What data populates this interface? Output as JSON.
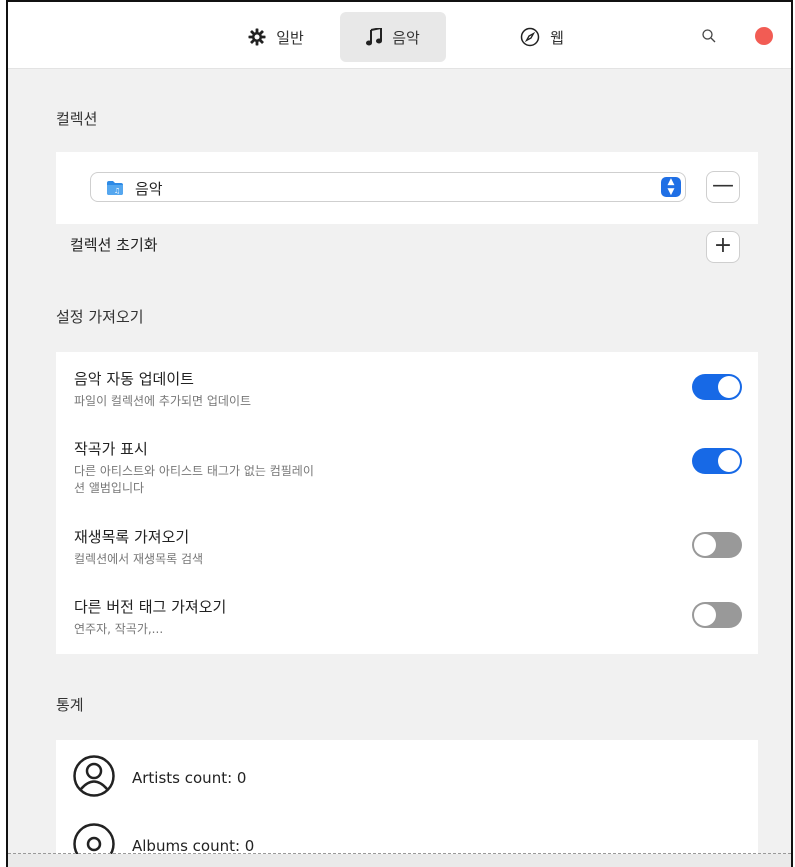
{
  "tabs": [
    {
      "label": "일반",
      "icon": "gear-icon"
    },
    {
      "label": "음악",
      "icon": "music-note-icon",
      "active": true
    },
    {
      "label": "웹",
      "icon": "compass-icon"
    }
  ],
  "collection": {
    "section_title": "컬렉션",
    "selected": "음악",
    "reset_label": "컬렉션 초기화",
    "remove_symbol": "—",
    "add_symbol": "+"
  },
  "import_settings": {
    "section_title": "설정 가져오기",
    "rows": [
      {
        "title": "음악 자동 업데이트",
        "desc": "파일이 컬렉션에 추가되면 업데이트",
        "on": true
      },
      {
        "title": "작곡가 표시",
        "desc": "다른 아티스트와 아티스트 태그가 없는 컴필레이션 앨범입니다",
        "on": true
      },
      {
        "title": "재생목록 가져오기",
        "desc": "컬렉션에서 재생목록 검색",
        "on": false
      },
      {
        "title": "다른 버전 태그 가져오기",
        "desc": "연주자, 작곡가,...",
        "on": false
      }
    ]
  },
  "stats": {
    "section_title": "통계",
    "items": [
      {
        "label": "Artists count: 0",
        "icon": "person-icon"
      },
      {
        "label": "Albums count: 0",
        "icon": "disc-icon"
      }
    ]
  },
  "colors": {
    "accent": "#1769e6",
    "close": "#f25c54"
  }
}
